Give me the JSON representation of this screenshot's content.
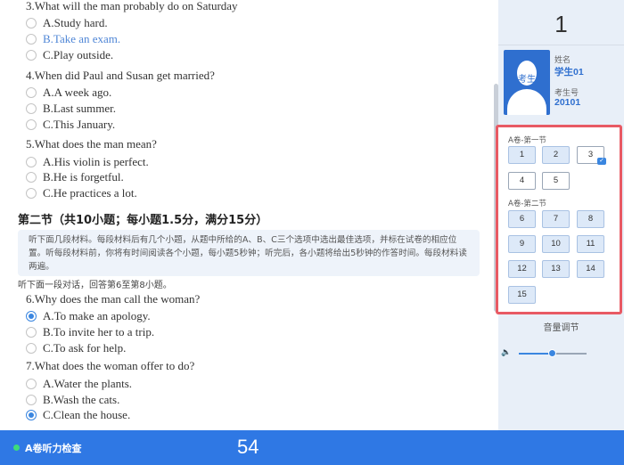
{
  "questions_top": [
    {
      "title": "3.What will the man probably do on Saturday",
      "options": [
        {
          "text": "A.Study hard.",
          "state": "none"
        },
        {
          "text": "B.Take an exam.",
          "state": "highlight"
        },
        {
          "text": "C.Play outside.",
          "state": "none"
        }
      ]
    },
    {
      "title": "4.When did Paul and Susan get married?",
      "options": [
        {
          "text": "A.A week ago.",
          "state": "none"
        },
        {
          "text": "B.Last summer.",
          "state": "none"
        },
        {
          "text": "C.This January.",
          "state": "none"
        }
      ]
    },
    {
      "title": "5.What does the man mean?",
      "options": [
        {
          "text": "A.His violin is perfect.",
          "state": "none"
        },
        {
          "text": "B.He is forgetful.",
          "state": "none"
        },
        {
          "text": "C.He practices a lot.",
          "state": "none"
        }
      ]
    }
  ],
  "section2": {
    "title": "第二节（共10小题；每小题1.5分，满分15分）",
    "instruction": "听下面几段材料。每段材料后有几个小题，从题中所给的A、B、C三个选项中选出最佳选项，并标在试卷的相应位置。听每段材料前，你将有时间阅读各个小题，每小题5秒钟；听完后，各小题将给出5秒钟的作答时间。每段材料读两遍。",
    "sub_instruction": "听下面一段对话，回答第6至第8小题。"
  },
  "questions_bottom": [
    {
      "title": "6.Why does the man call the woman?",
      "options": [
        {
          "text": "A.To make an apology.",
          "state": "checked"
        },
        {
          "text": "B.To invite her to a trip.",
          "state": "none"
        },
        {
          "text": "C.To ask for help.",
          "state": "none"
        }
      ]
    },
    {
      "title": "7.What does the woman offer to do?",
      "options": [
        {
          "text": "A.Water the plants.",
          "state": "none"
        },
        {
          "text": "B.Wash the cats.",
          "state": "none"
        },
        {
          "text": "C.Clean the house.",
          "state": "checked"
        }
      ]
    }
  ],
  "panel": {
    "current_number": "1",
    "avatar_text": "考生",
    "name_label": "姓名",
    "name_value": "学生01",
    "id_label": "考生号",
    "id_value": "20101",
    "group1": {
      "title": "A卷-第一节",
      "buttons": [
        {
          "label": "1",
          "state": "unanswered"
        },
        {
          "label": "2",
          "state": "unanswered"
        },
        {
          "label": "3",
          "state": "answered"
        },
        {
          "label": "4",
          "state": "plain"
        },
        {
          "label": "5",
          "state": "plain"
        }
      ]
    },
    "group2": {
      "title": "A卷-第二节",
      "buttons": [
        {
          "label": "6"
        },
        {
          "label": "7"
        },
        {
          "label": "8"
        },
        {
          "label": "9"
        },
        {
          "label": "10"
        },
        {
          "label": "11"
        },
        {
          "label": "12"
        },
        {
          "label": "13"
        },
        {
          "label": "14"
        },
        {
          "label": "15"
        }
      ]
    },
    "volume_label": "音量调节",
    "volume_level": 0.5,
    "volume_icon": "speaker-icon"
  },
  "bottom": {
    "title": "A卷听力检查",
    "timer": "54"
  },
  "colors": {
    "accent": "#2f78e4",
    "highlight_box": "#e85a64",
    "panel_bg": "#e8eff8"
  }
}
